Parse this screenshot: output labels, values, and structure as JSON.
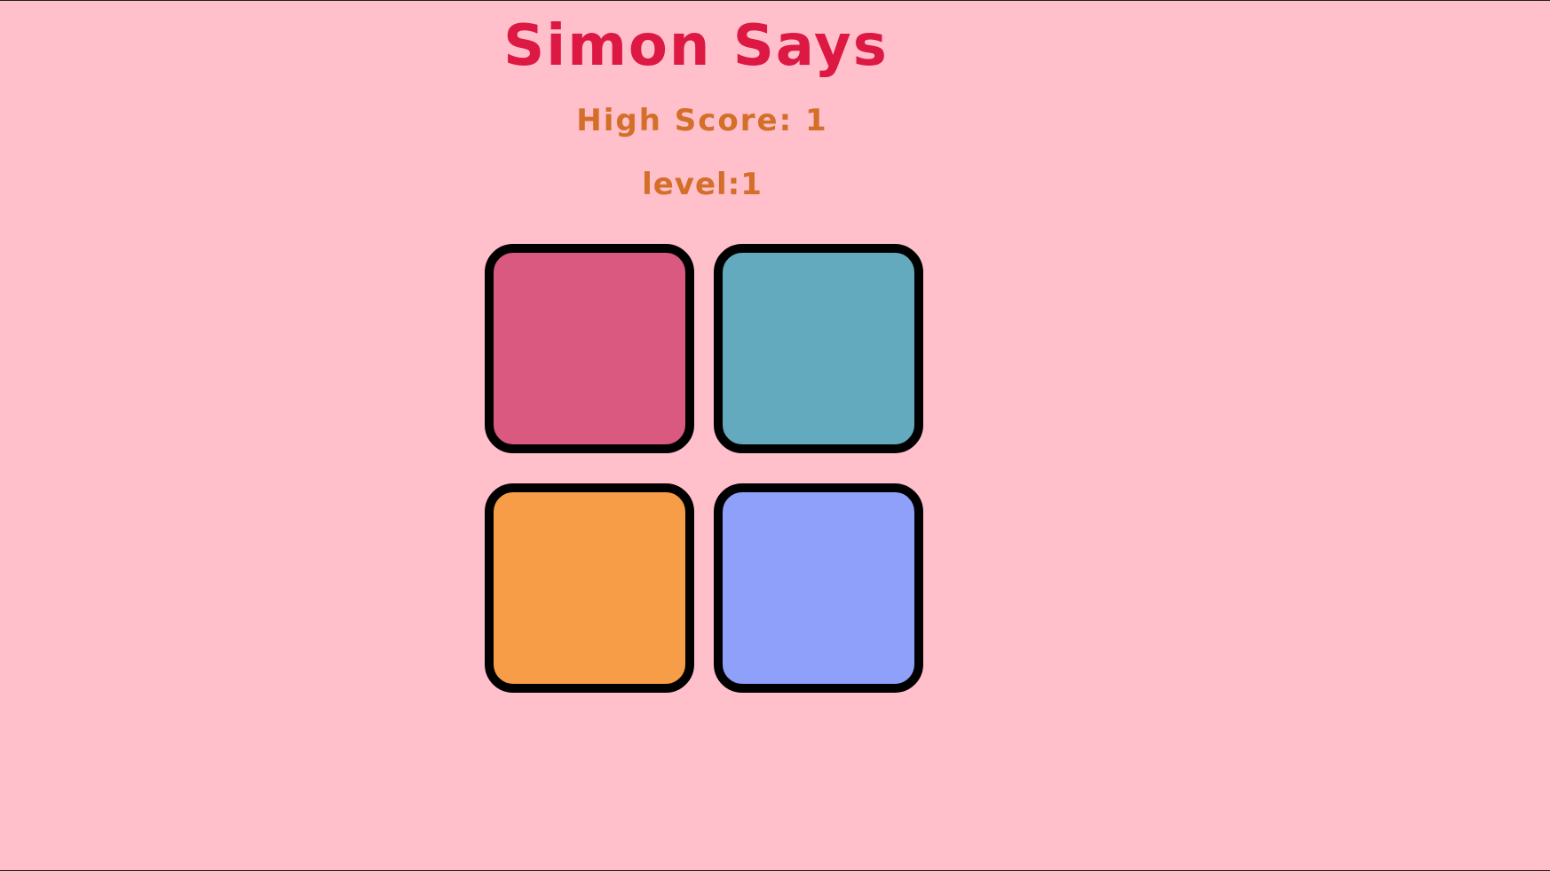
{
  "game": {
    "title": "Simon Says",
    "high_score_text": "High Score: 1",
    "level_text": "level:1"
  },
  "pads": [
    {
      "id": "red",
      "color": "#d95980"
    },
    {
      "id": "teal",
      "color": "#63aabf"
    },
    {
      "id": "orange",
      "color": "#f79c47"
    },
    {
      "id": "blue",
      "color": "#8fa0fa"
    }
  ],
  "colors": {
    "background": "#ffbfcb",
    "title": "#dc1843",
    "score_text": "#d36f28",
    "pad_border": "#000000"
  }
}
